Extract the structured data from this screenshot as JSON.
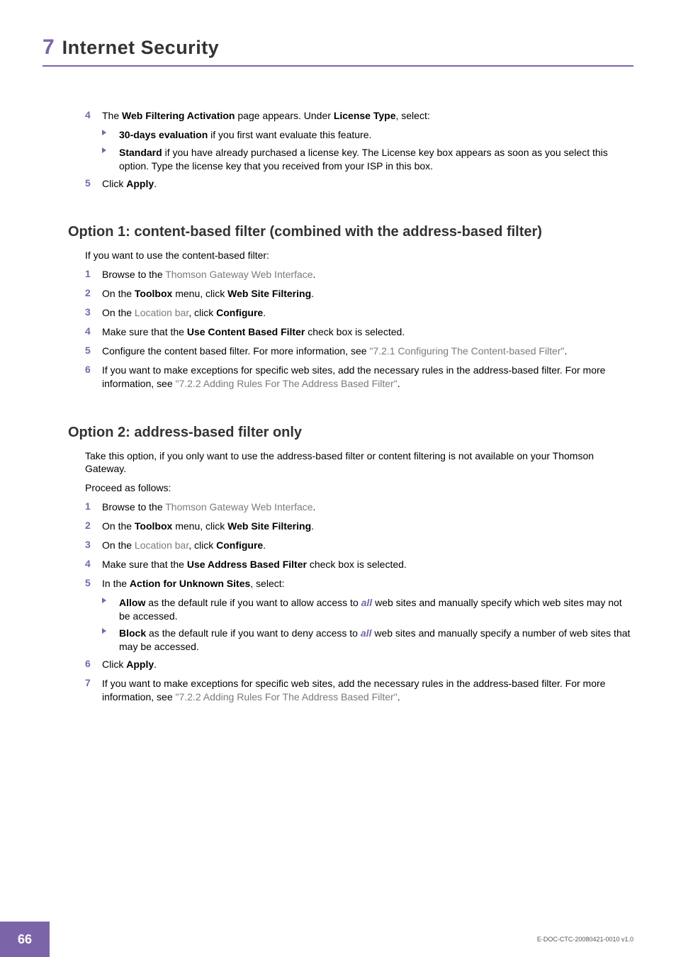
{
  "chapter": {
    "number": "7",
    "title": "Internet Security"
  },
  "top_steps": {
    "s4": {
      "num": "4",
      "lead_a": "The ",
      "bold1": "Web Filtering Activation",
      "mid1": " page appears. Under ",
      "bold2": "License Type",
      "tail": ", select:",
      "bullets": [
        {
          "bold": "30-days evaluation",
          "rest": " if you first want evaluate this feature."
        },
        {
          "bold": "Standard",
          "rest": " if you have already purchased a license key. The License key box appears as soon as you select this option. Type the license key that you received from your ISP in this box."
        }
      ]
    },
    "s5": {
      "num": "5",
      "lead": "Click ",
      "bold": "Apply",
      "tail": "."
    }
  },
  "option1": {
    "heading": "Option 1: content-based filter (combined with the address-based filter)",
    "intro": "If you want to use the content-based filter:",
    "steps": [
      {
        "num": "1",
        "parts": [
          {
            "t": "Browse to the "
          },
          {
            "t": "Thomson Gateway Web Interface",
            "link": true
          },
          {
            "t": "."
          }
        ]
      },
      {
        "num": "2",
        "parts": [
          {
            "t": "On the "
          },
          {
            "t": "Toolbox",
            "bold": true
          },
          {
            "t": " menu, click "
          },
          {
            "t": "Web Site Filtering",
            "bold": true
          },
          {
            "t": "."
          }
        ]
      },
      {
        "num": "3",
        "parts": [
          {
            "t": "On the "
          },
          {
            "t": "Location bar",
            "link": true
          },
          {
            "t": ", click "
          },
          {
            "t": "Configure",
            "bold": true
          },
          {
            "t": "."
          }
        ]
      },
      {
        "num": "4",
        "parts": [
          {
            "t": "Make sure that the "
          },
          {
            "t": "Use Content Based Filter",
            "bold": true
          },
          {
            "t": " check box is selected."
          }
        ]
      },
      {
        "num": "5",
        "parts": [
          {
            "t": "Configure the content based filter. For more information, see "
          },
          {
            "t": "\"7.2.1 Configuring The Content-based Filter\"",
            "link": true
          },
          {
            "t": "."
          }
        ]
      },
      {
        "num": "6",
        "parts": [
          {
            "t": "If you want to make exceptions for specific web sites, add the necessary rules in the address-based filter. For more information, see "
          },
          {
            "t": "\"7.2.2 Adding Rules For The Address Based Filter\"",
            "link": true
          },
          {
            "t": "."
          }
        ]
      }
    ]
  },
  "option2": {
    "heading": "Option 2: address-based filter only",
    "intro1": "Take this option, if you only want to use the address-based filter or content filtering is not available on your Thomson Gateway.",
    "intro2": "Proceed as follows:",
    "steps": [
      {
        "num": "1",
        "parts": [
          {
            "t": "Browse to the "
          },
          {
            "t": "Thomson Gateway Web Interface",
            "link": true
          },
          {
            "t": "."
          }
        ]
      },
      {
        "num": "2",
        "parts": [
          {
            "t": "On the "
          },
          {
            "t": "Toolbox",
            "bold": true
          },
          {
            "t": " menu, click "
          },
          {
            "t": "Web Site Filtering",
            "bold": true
          },
          {
            "t": "."
          }
        ]
      },
      {
        "num": "3",
        "parts": [
          {
            "t": "On the "
          },
          {
            "t": "Location bar",
            "link": true
          },
          {
            "t": ", click "
          },
          {
            "t": "Configure",
            "bold": true
          },
          {
            "t": "."
          }
        ]
      },
      {
        "num": "4",
        "parts": [
          {
            "t": "Make sure that the "
          },
          {
            "t": "Use Address Based Filter",
            "bold": true
          },
          {
            "t": " check box is selected."
          }
        ]
      },
      {
        "num": "5",
        "parts": [
          {
            "t": "In the "
          },
          {
            "t": "Action for Unknown Sites",
            "bold": true
          },
          {
            "t": ", select:"
          }
        ],
        "bullets": [
          {
            "parts": [
              {
                "t": "Allow",
                "bold": true
              },
              {
                "t": " as the default rule if you want to allow access to "
              },
              {
                "t": "all",
                "accent": true
              },
              {
                "t": " web sites and manually specify which web sites may not be accessed."
              }
            ]
          },
          {
            "parts": [
              {
                "t": "Block",
                "bold": true
              },
              {
                "t": " as the default rule if you want to deny access to "
              },
              {
                "t": "all",
                "accent": true
              },
              {
                "t": " web sites and manually specify a number of web sites that may be accessed."
              }
            ]
          }
        ]
      },
      {
        "num": "6",
        "parts": [
          {
            "t": "Click "
          },
          {
            "t": "Apply",
            "bold": true
          },
          {
            "t": "."
          }
        ]
      },
      {
        "num": "7",
        "parts": [
          {
            "t": "If you want to make exceptions for specific web sites, add the necessary rules in the address-based filter. For more information, see "
          },
          {
            "t": "\"7.2.2 Adding Rules For The Address Based Filter\"",
            "link": true
          },
          {
            "t": "."
          }
        ]
      }
    ]
  },
  "footer": {
    "page": "66",
    "docid": "E-DOC-CTC-20080421-0010 v1.0"
  }
}
